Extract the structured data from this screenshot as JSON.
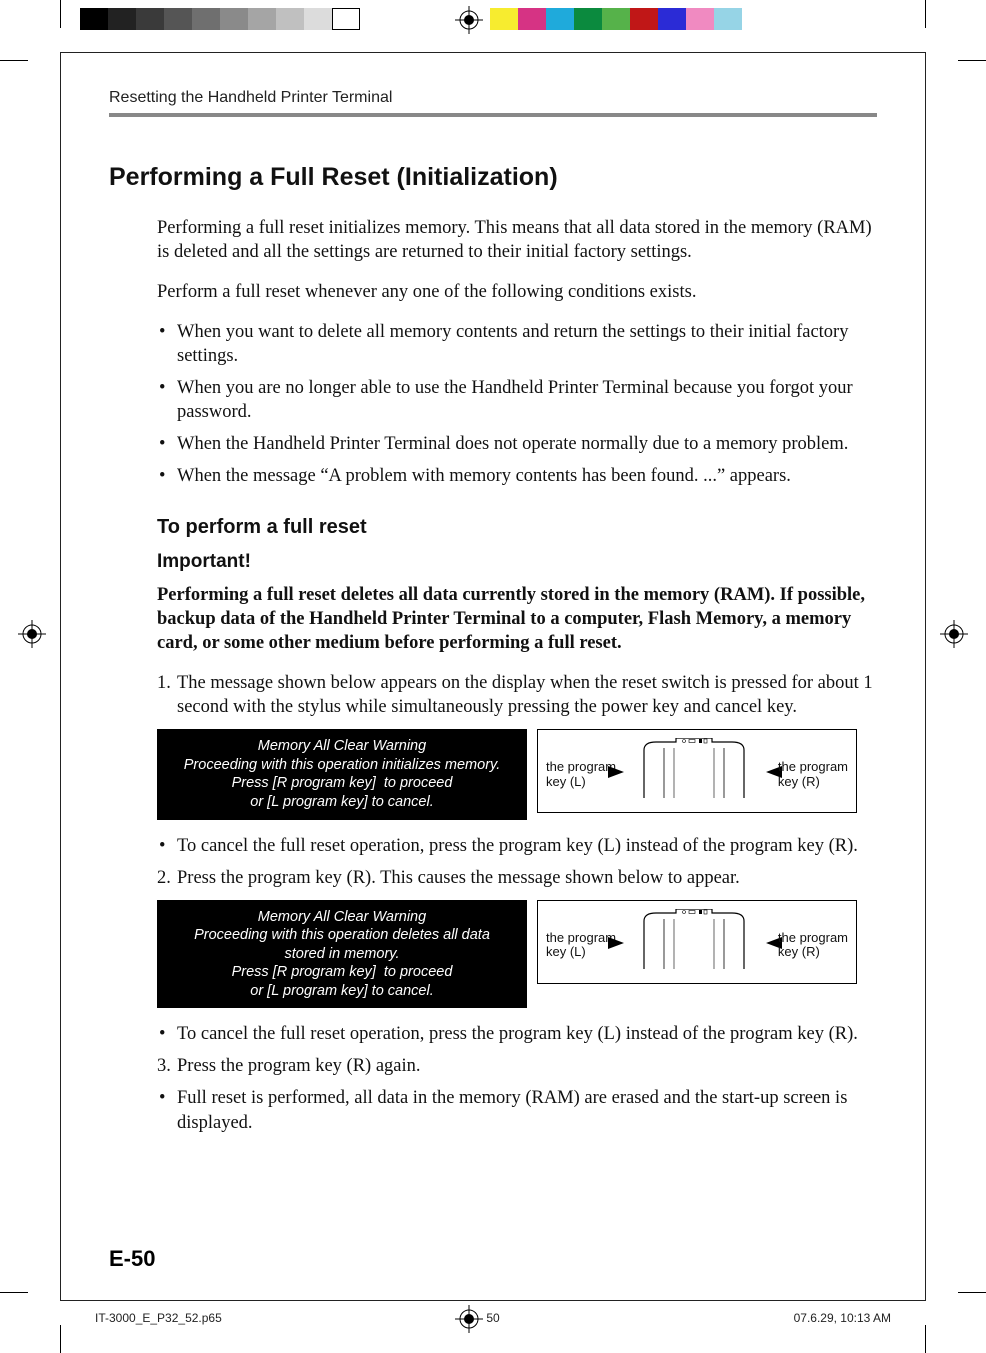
{
  "colorbar_left": [
    "#000000",
    "#222222",
    "#3a3a3a",
    "#555555",
    "#6f6f6f",
    "#8a8a8a",
    "#a5a5a5",
    "#c0c0c0",
    "#dcdcdc",
    "#ffffff"
  ],
  "colorbar_right": [
    "#f7ec2f",
    "#d63384",
    "#1faadb",
    "#0b8a3e",
    "#56b24a",
    "#c01717",
    "#2b2bd6",
    "#f08ac1",
    "#96d4e6",
    "#ffffff"
  ],
  "header": {
    "running": "Resetting the Handheld Printer Terminal"
  },
  "title": "Performing a Full Reset (Initialization)",
  "intro": "Performing a full reset initializes memory. This means that all data stored in the memory (RAM) is deleted and all the settings are returned to their initial factory settings.",
  "when_intro": "Perform a full reset whenever any one of the following conditions exists.",
  "when": [
    "When you want to delete all memory contents and return the settings to their initial factory settings.",
    "When you are no longer able to use the Handheld Printer Terminal because you forgot your password.",
    "When the Handheld Printer Terminal does not operate normally due to a memory problem.",
    "When the message “A problem with memory contents has been found. ...” appears."
  ],
  "sub_heading": "To perform a full reset",
  "important_label": "Important!",
  "important_text": "Performing a full reset deletes all data currently stored in the memory (RAM). If possible, backup data of the Handheld Printer Terminal to a computer, Flash Memory, a memory card, or some other medium before performing a full reset.",
  "steps": {
    "s1": "The message shown below appears on the display when the reset switch is pressed for about 1 second with the stylus while simultaneously pressing the power key and cancel key.",
    "s1_cancel": "To cancel the full reset operation, press the program key (L) instead of the program key (R).",
    "s2": "Press the program key (R). This causes the message shown below to appear.",
    "s2_cancel": "To cancel the full reset operation, press the program key (L) instead of the program key (R).",
    "s3": "Press the program key (R) again.",
    "s3_result": "Full reset is performed, all data in the memory (RAM) are erased and the start-up screen is displayed."
  },
  "lcd1": {
    "l1": "Memory All Clear Warning",
    "l2": "Proceeding with this operation initializes memory.",
    "l3": "Press [R program key]  to proceed",
    "l4": "or [L program key] to cancel."
  },
  "lcd2": {
    "l1": "Memory All Clear Warning",
    "l2": "Proceeding with this operation deletes all data",
    "l3": "stored in memory.",
    "l4": "Press [R program key]  to proceed",
    "l5": "or [L program key] to cancel."
  },
  "device_labels": {
    "left1": "the program",
    "left2": "key (L)",
    "right1": "the program",
    "right2": "key (R)"
  },
  "page_number": "E-50",
  "footer": {
    "file": "IT-3000_E_P32_52.p65",
    "page": "50",
    "date": "07.6.29, 10:13 AM"
  }
}
